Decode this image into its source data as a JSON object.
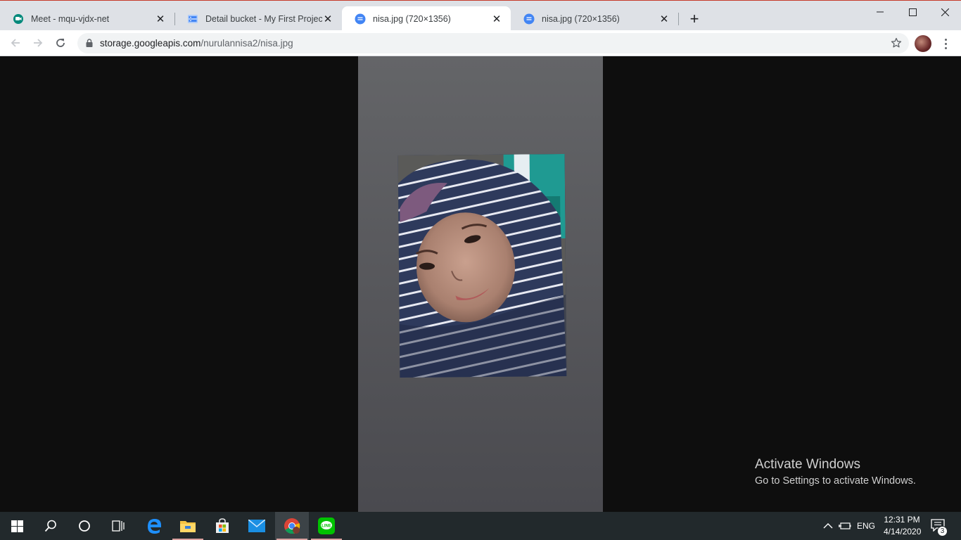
{
  "browser": {
    "tabs": [
      {
        "title": "Meet - mqu-vjdx-net",
        "icon": "google-meet-icon",
        "active": false
      },
      {
        "title": "Detail bucket - My First Project -",
        "icon": "cloud-storage-icon",
        "active": false
      },
      {
        "title": "nisa.jpg (720×1356)",
        "icon": "image-doc-icon",
        "active": true
      },
      {
        "title": "nisa.jpg (720×1356)",
        "icon": "image-doc-icon",
        "active": false
      }
    ],
    "address": {
      "host": "storage.googleapis.com",
      "path": "/nurulannisa2/nisa.jpg"
    },
    "colors": {
      "accent": "#4285f4",
      "tabstrip": "#dee1e6"
    }
  },
  "viewer": {
    "image_alt": "Selfie of a person wearing a navy striped hijab"
  },
  "watermark": {
    "line1": "Activate Windows",
    "line2": "Go to Settings to activate Windows."
  },
  "taskbar": {
    "apps": [
      "start",
      "search",
      "cortana",
      "task-view",
      "edge",
      "file-explorer",
      "store",
      "mail",
      "chrome",
      "line"
    ],
    "tray": {
      "language": "ENG",
      "time": "12:31 PM",
      "date": "4/14/2020",
      "notification_count": "3"
    }
  }
}
